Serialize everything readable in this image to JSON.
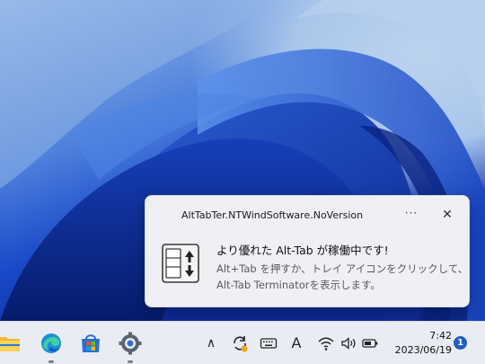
{
  "notification": {
    "app_name": "AltTabTer.NTWindSoftware.NoVersion",
    "more_icon": "more-horizontal-icon",
    "more_label": "···",
    "close_icon": "close-icon",
    "close_label": "✕",
    "icon": "alt-tab-terminator-app-icon",
    "title": "より優れた Alt-Tab が稼働中です!",
    "body_line1": "Alt+Tab を押すか、トレイ アイコンをクリックして、",
    "body_line2": "Alt-Tab Terminatorを表示します。"
  },
  "taskbar": {
    "pinned": [
      {
        "icon": "file-explorer-icon"
      },
      {
        "icon": "edge-browser-icon"
      },
      {
        "icon": "microsoft-store-icon"
      },
      {
        "icon": "settings-gear-icon"
      }
    ],
    "tray": {
      "show_hidden_icon": "chevron-up-icon",
      "show_hidden_label": "∧",
      "sync_icon": "refresh-icon",
      "keyboard_icon": "keyboard-icon",
      "ime_icon": "ime-mode-icon",
      "ime_label": "A",
      "wifi_icon": "wifi-icon",
      "volume_icon": "volume-icon",
      "battery_icon": "battery-icon"
    },
    "clock": {
      "time": "7:42",
      "date": "2023/06/19"
    },
    "notification_badge": "1"
  },
  "colors": {
    "taskbar_bg": "#e9edf3",
    "toast_bg": "#eef0f4",
    "badge": "#1f5fbf",
    "wallpaper_dark": "#0b2d9e",
    "wallpaper_light": "#a9c6ea"
  }
}
